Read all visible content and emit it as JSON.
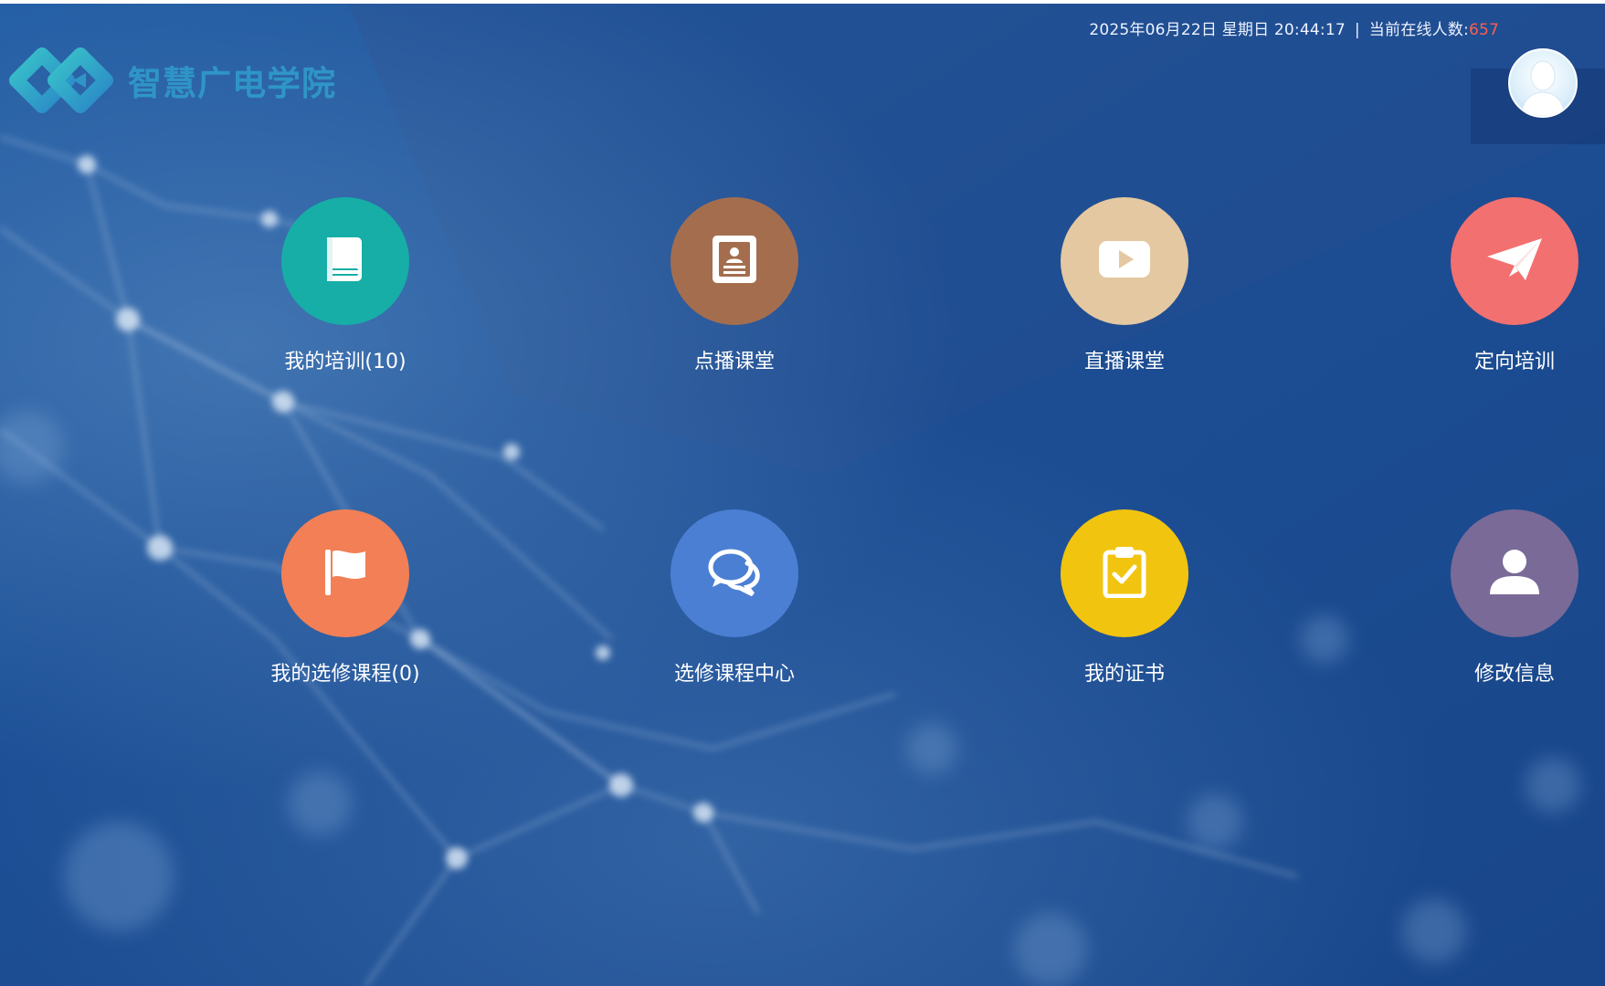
{
  "header": {
    "site_title": "智慧广电学院",
    "datetime": "2025年06月22日 星期日  20:44:17",
    "separator": "|",
    "online_label": "当前在线人数:",
    "online_count": "657",
    "online_count_color": "#ff5e4d",
    "logo_icon": "infinity-logo-icon",
    "avatar_icon": "user-avatar-icon"
  },
  "tiles": [
    {
      "label": "我的培训(10)",
      "icon": "book-icon",
      "color": "#17aea7"
    },
    {
      "label": "点播课堂",
      "icon": "contact-card-icon",
      "color": "#a46e4e"
    },
    {
      "label": "直播课堂",
      "icon": "play-icon",
      "color": "#e4c8a1"
    },
    {
      "label": "定向培训",
      "icon": "paper-plane-icon",
      "color": "#f2706f"
    },
    {
      "label": "我的选修课程(0)",
      "icon": "flag-icon",
      "color": "#f27f55"
    },
    {
      "label": "选修课程中心",
      "icon": "chat-bubbles-icon",
      "color": "#4a7fd4"
    },
    {
      "label": "我的证书",
      "icon": "clipboard-check-icon",
      "color": "#f1c40f"
    },
    {
      "label": "修改信息",
      "icon": "user-icon",
      "color": "#7a6a97"
    }
  ]
}
